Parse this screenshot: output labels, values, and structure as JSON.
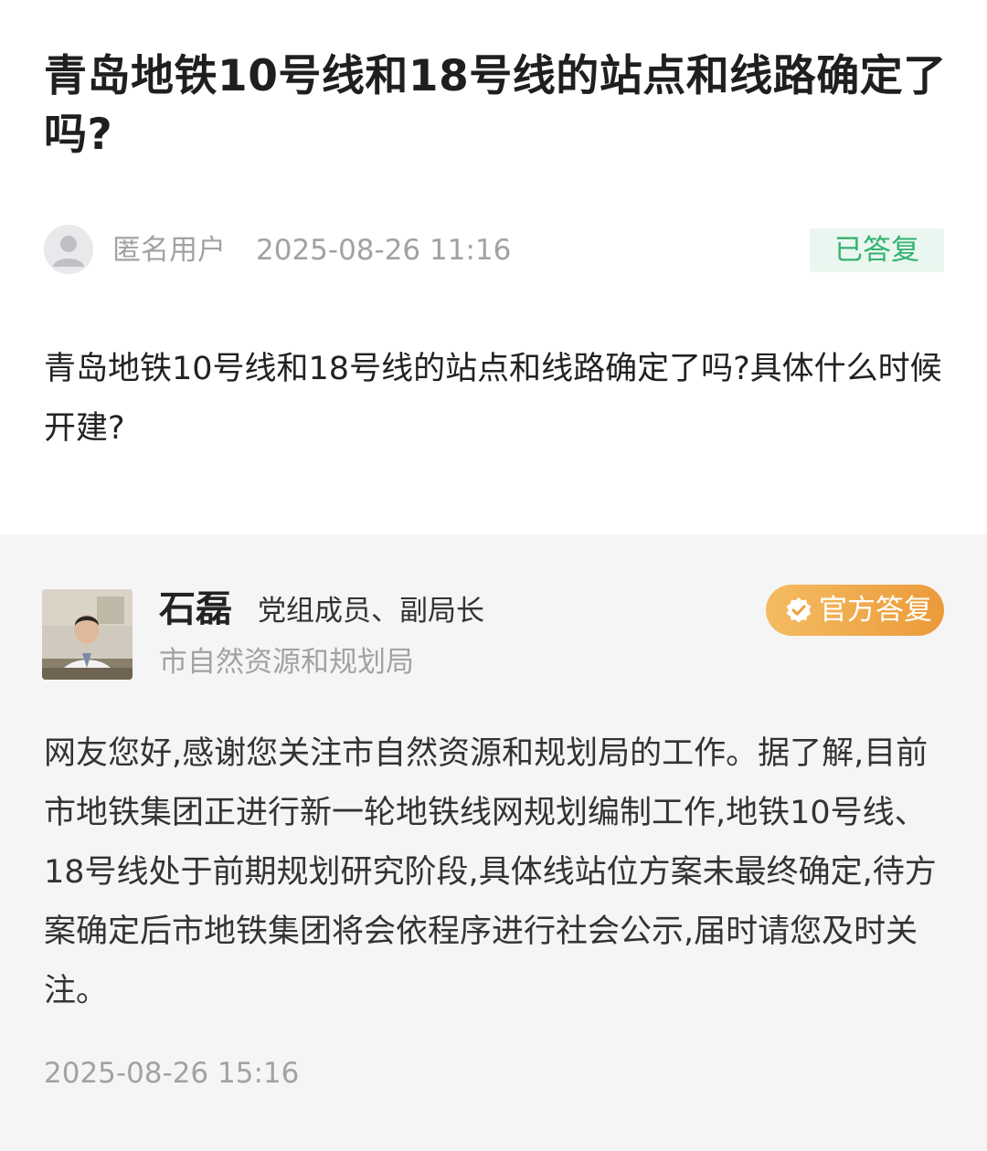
{
  "question": {
    "title": "青岛地铁10号线和18号线的站点和线路确定了吗?",
    "asker_name": "匿名用户",
    "asked_at": "2025-08-26 11:16",
    "status": "已答复",
    "body": "青岛地铁10号线和18号线的站点和线路确定了吗?具体什么时候开建?"
  },
  "answer": {
    "official_name": "石磊",
    "official_position": "党组成员、副局长",
    "department": "市自然资源和规划局",
    "badge_label": "官方答复",
    "badge_icon": "verified-check-icon",
    "body": "网友您好,感谢您关注市自然资源和规划局的工作。据了解,目前市地铁集团正进行新一轮地铁线网规划编制工作,地铁10号线、18号线处于前期规划研究阶段,具体线站位方案未最终确定,待方案确定后市地铁集团将会依程序进行社会公示,届时请您及时关注。",
    "answered_at": "2025-08-26 15:16"
  },
  "colors": {
    "status_text": "#33b26e",
    "status_bg": "#eaf7f0",
    "badge_gradient_start": "#f4bc62",
    "badge_gradient_end": "#ec9a3a",
    "answer_bg": "#f5f5f5",
    "muted_text": "#a2a2a2"
  }
}
